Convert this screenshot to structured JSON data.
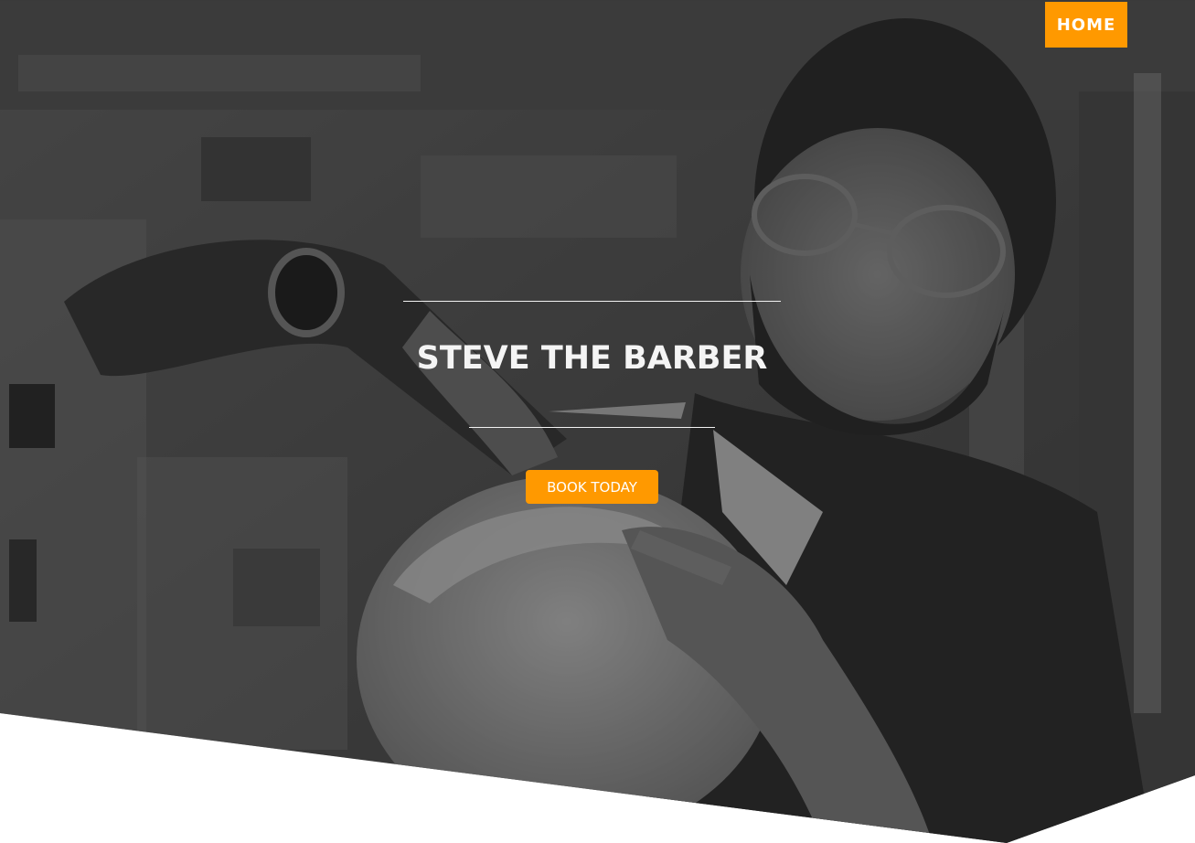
{
  "nav": {
    "home_label": "HOME"
  },
  "hero": {
    "title": "STEVE THE BARBER",
    "cta_label": "BOOK TODAY"
  },
  "colors": {
    "accent": "#ff9900",
    "text_light": "#f4f4f4",
    "background": "#ffffff"
  }
}
